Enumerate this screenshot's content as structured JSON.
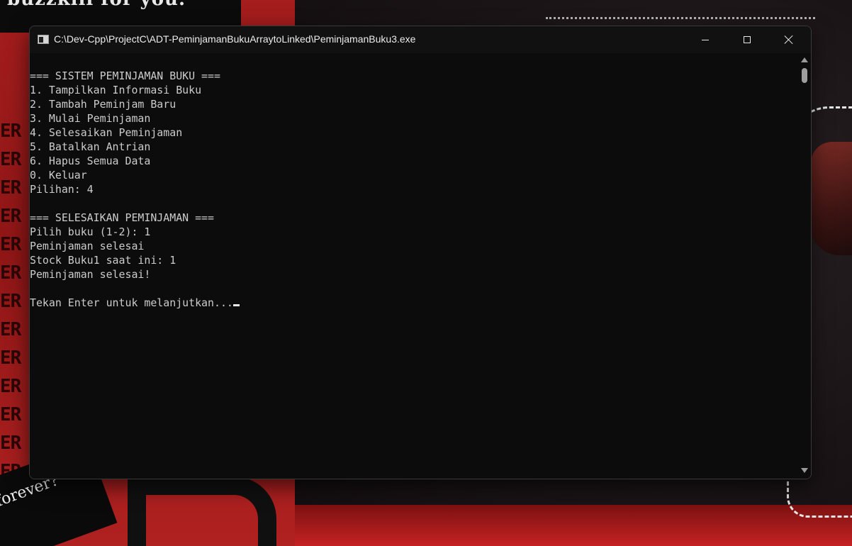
{
  "wallpaper": {
    "top_text": "buzzkill for you.",
    "sticker_text": "forever?",
    "repeat_text": [
      "ER",
      "ER",
      "ER",
      "ER",
      "ER",
      "ER",
      "ER",
      "ER",
      "ER",
      "ER",
      "ER",
      "ER",
      "ER"
    ]
  },
  "window": {
    "title": "C:\\Dev-Cpp\\ProjectC\\ADT-PeminjamanBukuArraytoLinked\\PeminjamanBuku3.exe",
    "icon": "console-app-icon",
    "controls": {
      "minimize": "minimize-icon",
      "maximize": "maximize-icon",
      "close": "close-icon"
    }
  },
  "console": {
    "lines": [
      "=== SISTEM PEMINJAMAN BUKU ===",
      "1. Tampilkan Informasi Buku",
      "2. Tambah Peminjam Baru",
      "3. Mulai Peminjaman",
      "4. Selesaikan Peminjaman",
      "5. Batalkan Antrian",
      "6. Hapus Semua Data",
      "0. Keluar",
      "Pilihan: 4",
      "",
      "=== SELESAIKAN PEMINJAMAN ===",
      "Pilih buku (1-2): 1",
      "Peminjaman selesai",
      "Stock Buku1 saat ini: 1",
      "Peminjaman selesai!",
      "",
      "Tekan Enter untuk melanjutkan..."
    ]
  },
  "colors": {
    "console_bg": "#0c0c0c",
    "console_text": "#cccccc",
    "wallpaper_red": "#a51d1d"
  }
}
